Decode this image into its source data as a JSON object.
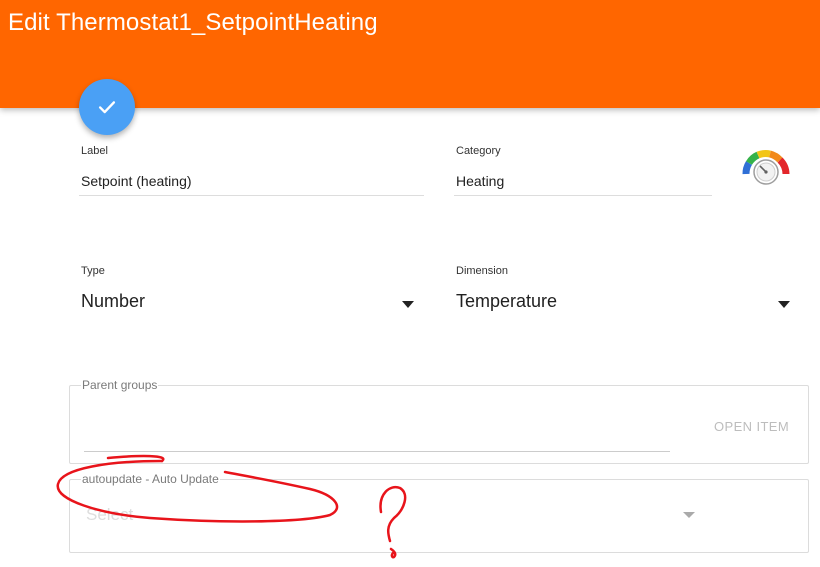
{
  "header": {
    "title": "Edit Thermostat1_SetpointHeating"
  },
  "fab": {
    "icon": "check-icon",
    "color": "#4aa0f5"
  },
  "form": {
    "label": {
      "caption": "Label",
      "value": "Setpoint (heating)"
    },
    "category": {
      "caption": "Category",
      "value": "Heating",
      "icon": "gauge-icon"
    },
    "type": {
      "caption": "Type",
      "value": "Number"
    },
    "dimension": {
      "caption": "Dimension",
      "value": "Temperature"
    },
    "parent_groups": {
      "caption": "Parent groups",
      "value": "",
      "action": "OPEN ITEM"
    },
    "autoupdate": {
      "caption": "autoupdate - Auto Update",
      "placeholder": "Select"
    }
  },
  "colors": {
    "header": "#ff6600",
    "accent": "#4aa0f5",
    "annotation": "#e8141b"
  }
}
